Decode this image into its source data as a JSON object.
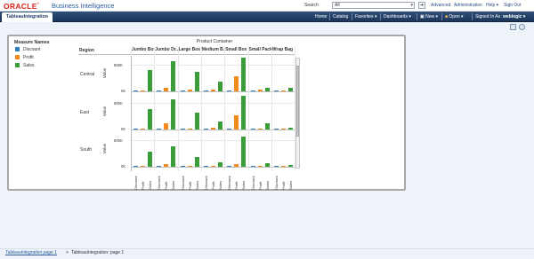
{
  "header": {
    "logo": "ORACLE",
    "logo_tm": "®",
    "product": "Business Intelligence",
    "search_label": "Search",
    "search_value": "All",
    "links": [
      "Advanced",
      "Administration",
      "Help ▾",
      "Sign Out"
    ]
  },
  "nav": {
    "tab": "TableauIntegration",
    "items": [
      "Home",
      "Catalog",
      "Favorites ▾",
      "Dashboards ▾",
      "New ▾",
      "Open ▾",
      "Signed In As"
    ],
    "user": "weblogic ▾"
  },
  "chart_data": {
    "type": "bar",
    "legend_title": "Measure Names",
    "column_group_title": "Product Container",
    "row_header_title": "Region",
    "ylabel": "Value",
    "measures": [
      {
        "name": "Discount",
        "color": "#2f7ec1"
      },
      {
        "name": "Profit",
        "color": "#f28a1c"
      },
      {
        "name": "Sales",
        "color": "#3a9d3a"
      }
    ],
    "columns": [
      "Jumbo Box",
      "Jumbo Dr..",
      "Large Box",
      "Medium B..",
      "Small Box",
      "Small Pack",
      "Wrap Bag"
    ],
    "rows": [
      {
        "region": "Central",
        "ticks": [
          "500K",
          "0K"
        ],
        "ymax": 500000,
        "values": [
          {
            "Discount": 3000,
            "Profit": 15000,
            "Sales": 400000
          },
          {
            "Discount": 3000,
            "Profit": 60000,
            "Sales": 560000
          },
          {
            "Discount": 3000,
            "Profit": 35000,
            "Sales": 360000
          },
          {
            "Discount": 3000,
            "Profit": 40000,
            "Sales": 180000
          },
          {
            "Discount": 3000,
            "Profit": 280000,
            "Sales": 970000
          },
          {
            "Discount": 2000,
            "Profit": 35000,
            "Sales": 70000
          },
          {
            "Discount": 2000,
            "Profit": 10000,
            "Sales": 60000
          }
        ]
      },
      {
        "region": "East",
        "ticks": [
          "500K",
          "0K"
        ],
        "ymax": 500000,
        "values": [
          {
            "Discount": 3000,
            "Profit": 15000,
            "Sales": 380000
          },
          {
            "Discount": 3000,
            "Profit": 120000,
            "Sales": 560000
          },
          {
            "Discount": 3000,
            "Profit": 15000,
            "Sales": 320000
          },
          {
            "Discount": 3000,
            "Profit": 25000,
            "Sales": 150000
          },
          {
            "Discount": 3000,
            "Profit": 260000,
            "Sales": 970000
          },
          {
            "Discount": 2000,
            "Profit": 15000,
            "Sales": 120000
          },
          {
            "Discount": 2000,
            "Profit": 5000,
            "Sales": 40000
          }
        ]
      },
      {
        "region": "South",
        "ticks": [
          "500K",
          "0K"
        ],
        "ymax": 500000,
        "values": [
          {
            "Discount": 3000,
            "Profit": 0,
            "Sales": 280000
          },
          {
            "Discount": 3000,
            "Profit": 50000,
            "Sales": 380000
          },
          {
            "Discount": 3000,
            "Profit": 0,
            "Sales": 180000
          },
          {
            "Discount": 3000,
            "Profit": 5000,
            "Sales": 90000
          },
          {
            "Discount": 3000,
            "Profit": 50000,
            "Sales": 560000
          },
          {
            "Discount": 2000,
            "Profit": 5000,
            "Sales": 60000
          },
          {
            "Discount": 2000,
            "Profit": 5000,
            "Sales": 40000
          }
        ]
      }
    ]
  },
  "footer": {
    "crumb_link": "TableauIntegration page 1",
    "separator": ">",
    "crumb_current": "TableauIntegration: page 1"
  }
}
